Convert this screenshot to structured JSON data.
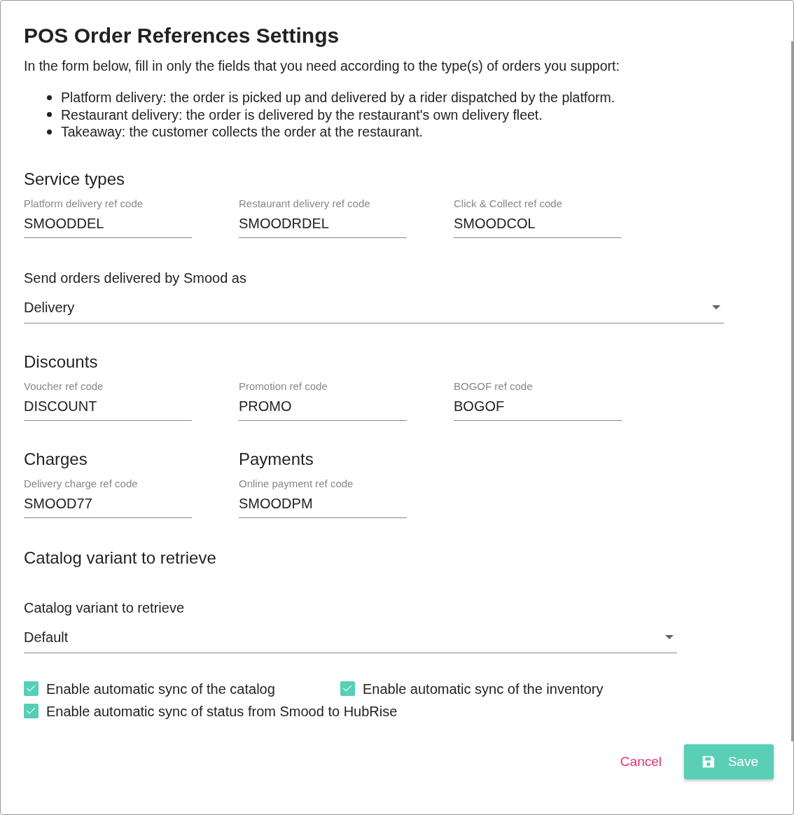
{
  "title": "POS Order References Settings",
  "intro": "In the form below, fill in only the fields that you need according to the type(s) of orders you support:",
  "bullets": [
    "Platform delivery: the order is picked up and delivered by a rider dispatched by the platform.",
    "Restaurant delivery: the order is delivered by the restaurant's own delivery fleet.",
    "Takeaway: the customer collects the order at the restaurant."
  ],
  "service_types": {
    "heading": "Service types",
    "fields": [
      {
        "label": "Platform delivery ref code",
        "value": "SMOODDEL"
      },
      {
        "label": "Restaurant delivery ref code",
        "value": "SMOODRDEL"
      },
      {
        "label": "Click & Collect ref code",
        "value": "SMOODCOL"
      }
    ]
  },
  "delivered_as": {
    "label": "Send orders delivered by Smood as",
    "value": "Delivery"
  },
  "discounts": {
    "heading": "Discounts",
    "fields": [
      {
        "label": "Voucher ref code",
        "value": "DISCOUNT"
      },
      {
        "label": "Promotion ref code",
        "value": "PROMO"
      },
      {
        "label": "BOGOF ref code",
        "value": "BOGOF"
      }
    ]
  },
  "charges": {
    "heading": "Charges",
    "fields": [
      {
        "label": "Delivery charge ref code",
        "value": "SMOOD77"
      }
    ]
  },
  "payments": {
    "heading": "Payments",
    "fields": [
      {
        "label": "Online payment ref code",
        "value": "SMOODPM"
      }
    ]
  },
  "catalog": {
    "heading": "Catalog variant to retrieve",
    "select": {
      "label": "Catalog variant to retrieve",
      "value": "Default"
    }
  },
  "options": [
    {
      "label": "Enable automatic sync of the catalog",
      "checked": true
    },
    {
      "label": "Enable automatic sync of the inventory",
      "checked": true
    },
    {
      "label": "Enable automatic sync of status from Smood to HubRise",
      "checked": true
    }
  ],
  "buttons": [
    {
      "label": "Cancel",
      "kind": "text"
    },
    {
      "label": "Save",
      "kind": "primary"
    }
  ]
}
